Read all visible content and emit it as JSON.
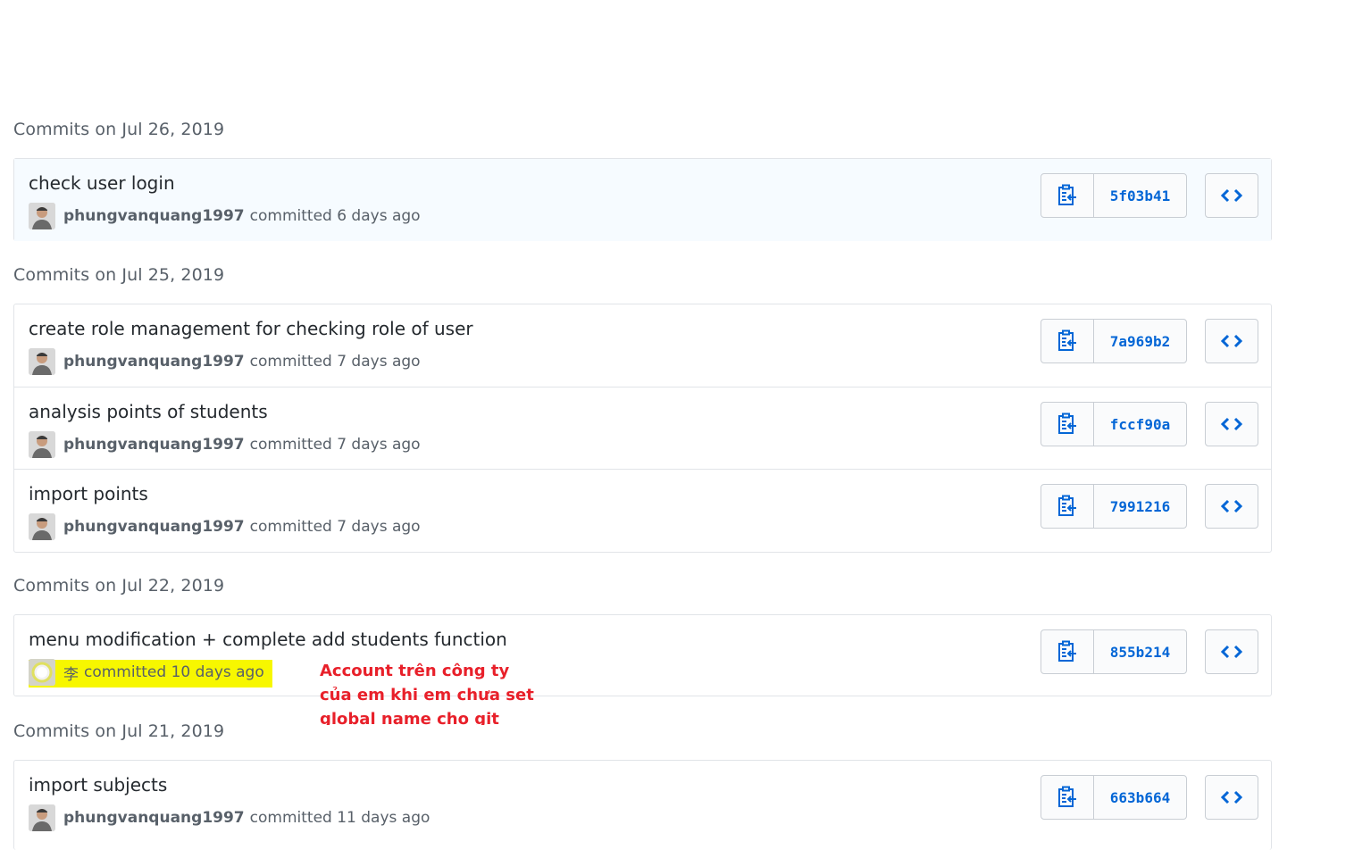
{
  "groups": [
    {
      "header": "Commits on Jul 26, 2019",
      "commits": [
        {
          "message": "check user login",
          "author": "phungvanquang1997",
          "when": "committed 6 days ago",
          "sha": "5f03b41"
        }
      ]
    },
    {
      "header": "Commits on Jul 25, 2019",
      "commits": [
        {
          "message": "create role management for checking role of user",
          "author": "phungvanquang1997",
          "when": "committed 7 days ago",
          "sha": "7a969b2"
        },
        {
          "message": "analysis points of students",
          "author": "phungvanquang1997",
          "when": "committed 7 days ago",
          "sha": "fccf90a"
        },
        {
          "message": "import points",
          "author": "phungvanquang1997",
          "when": "committed 7 days ago",
          "sha": "7991216"
        }
      ]
    },
    {
      "header": "Commits on Jul 22, 2019",
      "commits": [
        {
          "message": "menu modification + complete add students function",
          "author": "李",
          "when": "committed 10 days ago",
          "sha": "855b214"
        }
      ]
    },
    {
      "header": "Commits on Jul 21, 2019",
      "commits": [
        {
          "message": "import subjects",
          "author": "phungvanquang1997",
          "when": "committed 11 days ago",
          "sha": "663b664"
        }
      ]
    }
  ],
  "annotation": {
    "lines": [
      "Account trên công ty",
      "của em khi em chưa set",
      "global name cho git"
    ],
    "color": "#e8202a"
  },
  "highlight_color": "#f7f700",
  "icons": {
    "copy": "clippy-icon",
    "browse": "code-icon"
  },
  "colors": {
    "link": "#0366d6",
    "muted": "#586069",
    "border": "#e1e4e8"
  }
}
